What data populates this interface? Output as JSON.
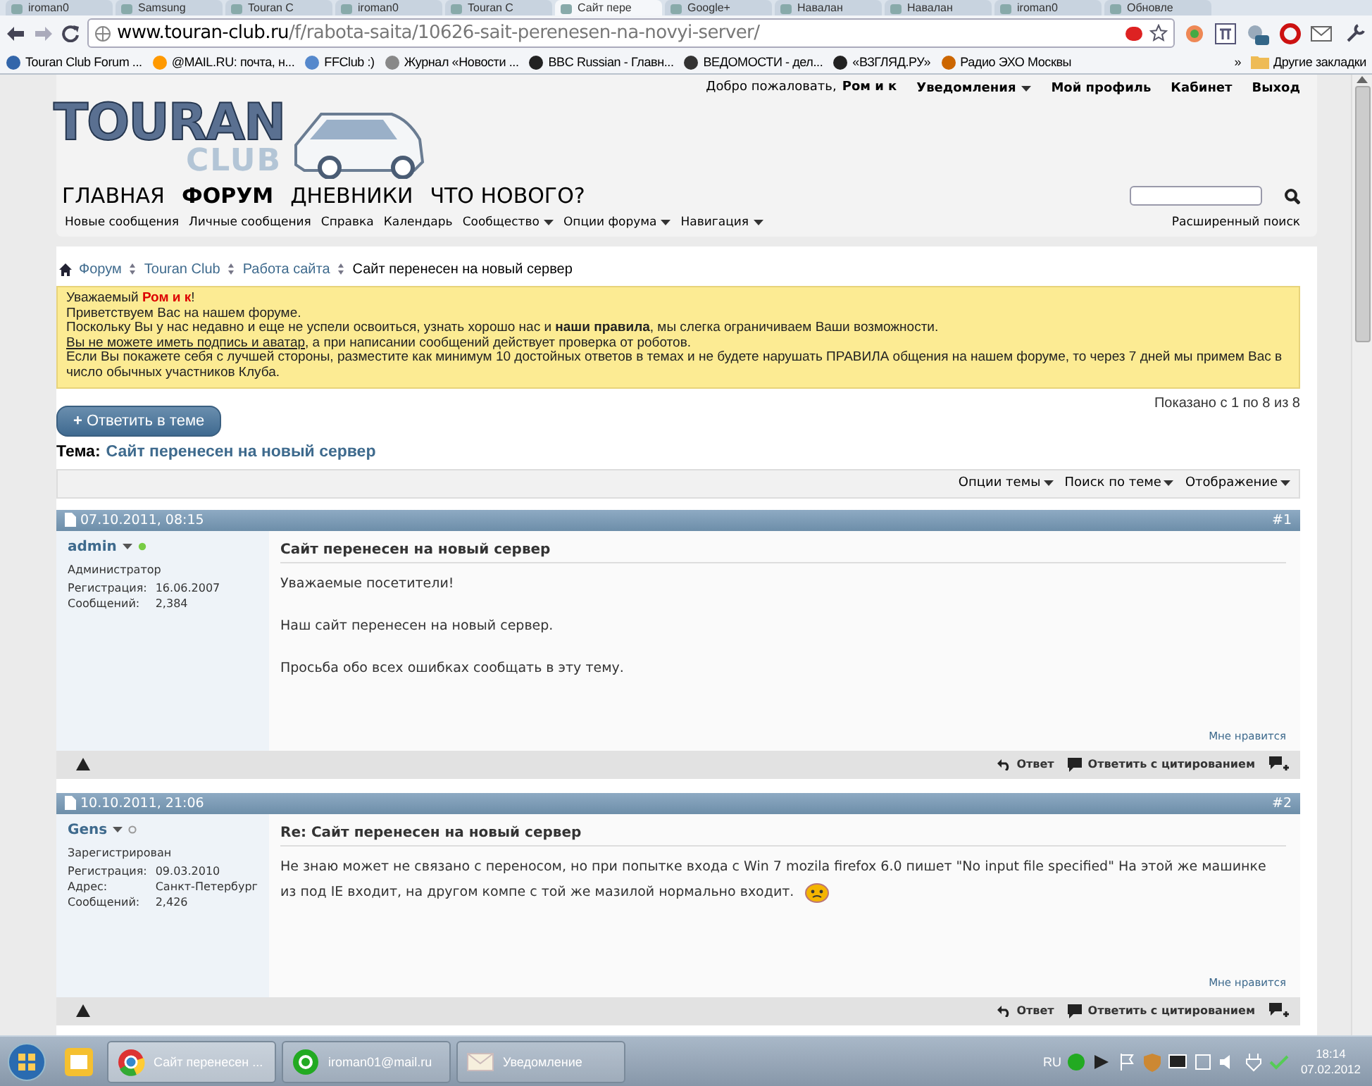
{
  "browser": {
    "tabs": [
      {
        "label": "iroman0",
        "selected": false
      },
      {
        "label": "Samsung",
        "selected": false
      },
      {
        "label": "Touran C",
        "selected": false
      },
      {
        "label": "iroman0",
        "selected": false
      },
      {
        "label": "Touran C",
        "selected": false
      },
      {
        "label": "Сайт пере",
        "selected": true
      },
      {
        "label": "Google+",
        "selected": false
      },
      {
        "label": "Навалан",
        "selected": false
      },
      {
        "label": "Навалан",
        "selected": false
      },
      {
        "label": "iroman0",
        "selected": false
      },
      {
        "label": "Обновле",
        "selected": false
      }
    ],
    "url": {
      "host": "www.touran-club.ru",
      "path": "/f/rabota-saita/10626-sait-perenesen-na-novyi-server/"
    },
    "bookmarks": [
      {
        "label": "Touran Club Forum ..."
      },
      {
        "label": "@MAIL.RU: почта, н..."
      },
      {
        "label": "FFClub :)"
      },
      {
        "label": "Журнал «Новости ..."
      },
      {
        "label": "BBC Russian - Главн..."
      },
      {
        "label": "ВЕДОМОСТИ - дел..."
      },
      {
        "label": "«ВЗГЛЯД.РУ»"
      },
      {
        "label": "Радио ЭХО Москвы"
      }
    ],
    "more": "»",
    "other_bookmarks": "Другие закладки"
  },
  "header": {
    "welcome": "Добро пожаловать,",
    "user": "Ром и к",
    "user_links": [
      {
        "label": "Уведомления",
        "dropdown": true
      },
      {
        "label": "Мой профиль",
        "dropdown": false
      },
      {
        "label": "Кабинет",
        "dropdown": false
      },
      {
        "label": "Выход",
        "dropdown": false
      }
    ],
    "logo": {
      "top": "TOURAN",
      "bottom": "CLUB"
    },
    "nav": [
      {
        "label": "ГЛАВНАЯ",
        "selected": false
      },
      {
        "label": "ФОРУМ",
        "selected": true
      },
      {
        "label": "ДНЕВНИКИ",
        "selected": false
      },
      {
        "label": "ЧТО НОВОГО?",
        "selected": false
      }
    ],
    "subnav": [
      {
        "label": "Новые сообщения",
        "dropdown": false
      },
      {
        "label": "Личные сообщения",
        "dropdown": false
      },
      {
        "label": "Справка",
        "dropdown": false
      },
      {
        "label": "Календарь",
        "dropdown": false
      },
      {
        "label": "Сообщество",
        "dropdown": true
      },
      {
        "label": "Опции форума",
        "dropdown": true
      },
      {
        "label": "Навигация",
        "dropdown": true
      }
    ],
    "advanced_search": "Расширенный поиск"
  },
  "breadcrumbs": [
    "Форум",
    "Touran Club",
    "Работа сайта",
    "Сайт перенесен на новый сервер"
  ],
  "notice": {
    "greeting": "Уважаемый **Ром и к**!",
    "lines": [
      "Приветствуем Вас на нашем форуме.",
      "Поскольку Вы у нас недавно и еще не успели освоиться, узнать хорошо нас и **наши правила**, мы слегка ограничиваем Ваши возможности."
    ],
    "link": "Вы не можете иметь подпись и аватар",
    "link_rest": ", а при написании сообщений действует проверка от роботов.",
    "closing": "Если Вы покажете себя с лучшей стороны, разместите как минимум 10 достойных ответов в темах и не будете нарушать ПРАВИЛА общения на нашем форуме, то через 7 дней мы примем Вас в число обычных участников Клуба."
  },
  "reply_button": {
    "icon": "+",
    "label": "Ответить в теме"
  },
  "showing": "Показано с 1 по 8 из 8",
  "thread": {
    "prefix": "Тема:",
    "title": "Сайт перенесен на новый сервер"
  },
  "thread_tools": [
    "Опции темы",
    "Поиск по теме",
    "Отображение"
  ],
  "posts": [
    {
      "date": "07.10.2011, 08:15",
      "number": "#1",
      "author": "admin",
      "online": true,
      "role": "Администратор",
      "details": [
        {
          "label": "Регистрация:",
          "value": "16.06.2007"
        },
        {
          "label": "Сообщений:",
          "value": "2,384"
        }
      ],
      "title": "Сайт перенесен на новый сервер",
      "paragraphs": [
        "Уважаемые посетители!",
        "Наш сайт перенесен на новый сервер.",
        "Просьба обо всех ошибках сообщать в эту тему."
      ],
      "smiley": false,
      "like": "Мне нравится",
      "reply": "Ответ",
      "quote": "Ответить с цитированием"
    },
    {
      "date": "10.10.2011, 21:06",
      "number": "#2",
      "author": "Gens",
      "online": false,
      "role": "Зарегистрирован",
      "details": [
        {
          "label": "Регистрация:",
          "value": "09.03.2010"
        },
        {
          "label": "Адрес:",
          "value": "Санкт-Петербург"
        },
        {
          "label": "Сообщений:",
          "value": "2,426"
        }
      ],
      "title": "Re: Сайт перенесен на новый сервер",
      "paragraphs": [
        "Не знаю может не связано с переносом, но при попытке входа с Win 7 mozila firefox 6.0 пишет \"No input file specified\" На этой же машинке из под IE входит, на другом компе с той же мазилой нормально входит."
      ],
      "smiley": true,
      "like": "Мне нравится",
      "reply": "Ответ",
      "quote": "Ответить с цитированием"
    }
  ],
  "taskbar": {
    "items": [
      {
        "kind": "chrome",
        "label": "Сайт перенесен ...",
        "selected": true
      },
      {
        "kind": "agent",
        "label": "iroman01@mail.ru",
        "selected": false
      },
      {
        "kind": "mail",
        "label": "Уведомление",
        "selected": false
      }
    ],
    "lang": "RU",
    "time": "18:14",
    "date": "07.02.2012"
  }
}
